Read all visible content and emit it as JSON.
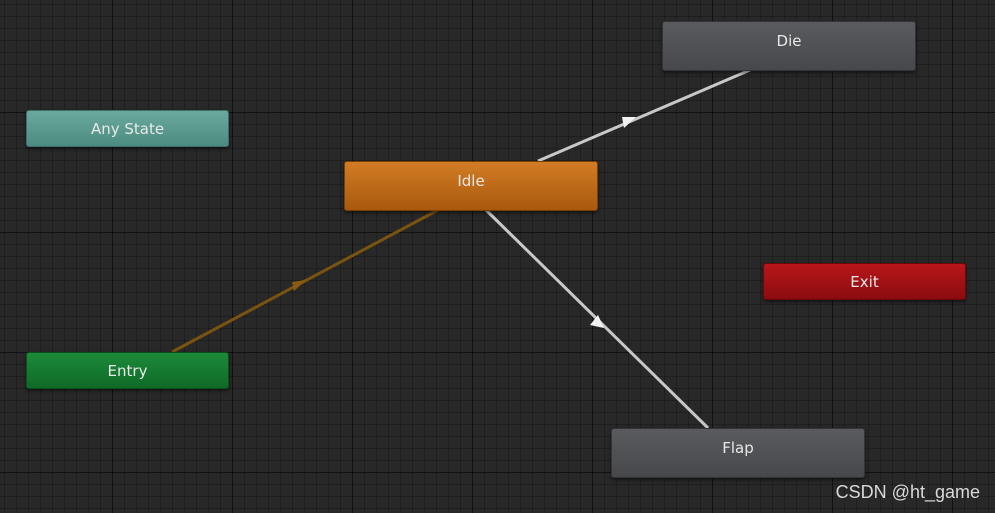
{
  "graph": {
    "nodes": {
      "any_state": "Any State",
      "entry": "Entry",
      "exit": "Exit",
      "idle": "Idle",
      "die": "Die",
      "flap": "Flap"
    }
  },
  "colors": {
    "grid_background": "#282828",
    "any_state": "#5b9a8e",
    "entry": "#138033",
    "exit": "#a01015",
    "idle": "#c36e1b",
    "state": "#4f5054",
    "default_transition": "#8a5a10",
    "transition": "#c8c8c8"
  },
  "watermark": "CSDN @ht_game"
}
